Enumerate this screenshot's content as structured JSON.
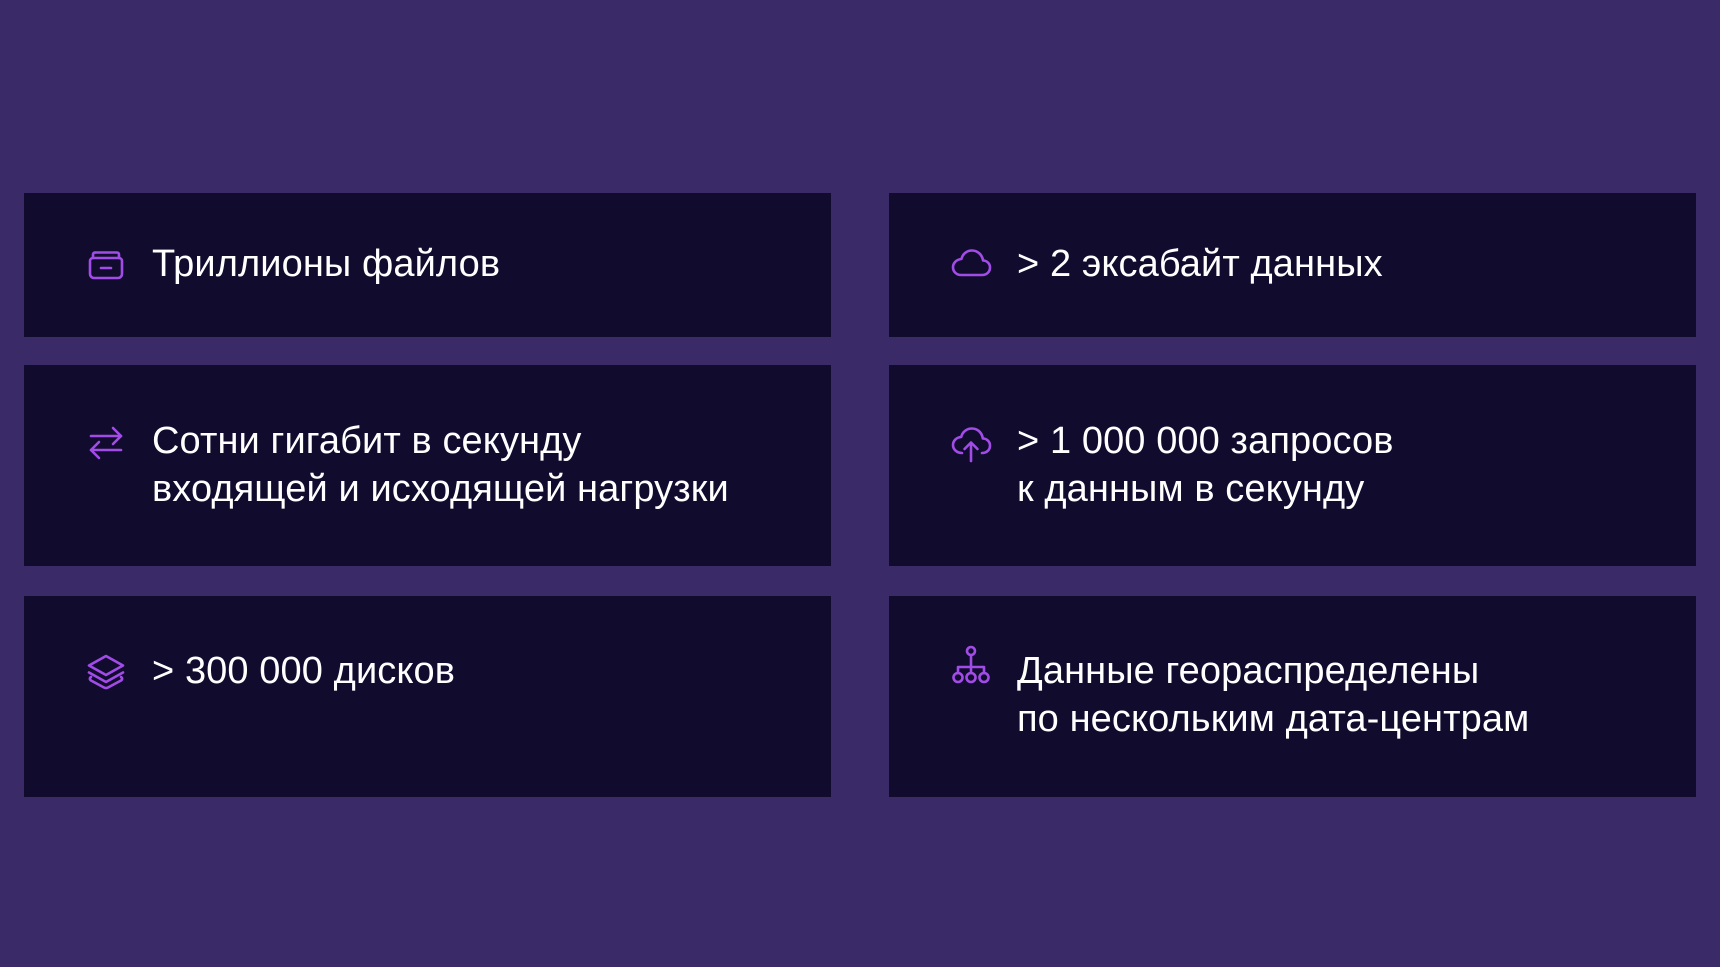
{
  "accent_color": "#a24ce8",
  "background_color": "#3a2a68",
  "card_color": "#110b2e",
  "cards": [
    {
      "icon": "storage-box-icon",
      "lines": [
        "Триллионы файлов"
      ]
    },
    {
      "icon": "cloud-icon",
      "lines": [
        "> 2 эксабайт данных"
      ]
    },
    {
      "icon": "transfer-arrows-icon",
      "lines": [
        "Сотни гигабит в секунду",
        "входящей и исходящей нагрузки"
      ]
    },
    {
      "icon": "cloud-upload-icon",
      "lines": [
        "> 1 000 000 запросов",
        "к данным в секунду"
      ]
    },
    {
      "icon": "layers-icon",
      "lines": [
        "> 300 000 дисков"
      ]
    },
    {
      "icon": "network-hierarchy-icon",
      "lines": [
        "Данные геораспределены",
        "по нескольким дата-центрам"
      ]
    }
  ]
}
